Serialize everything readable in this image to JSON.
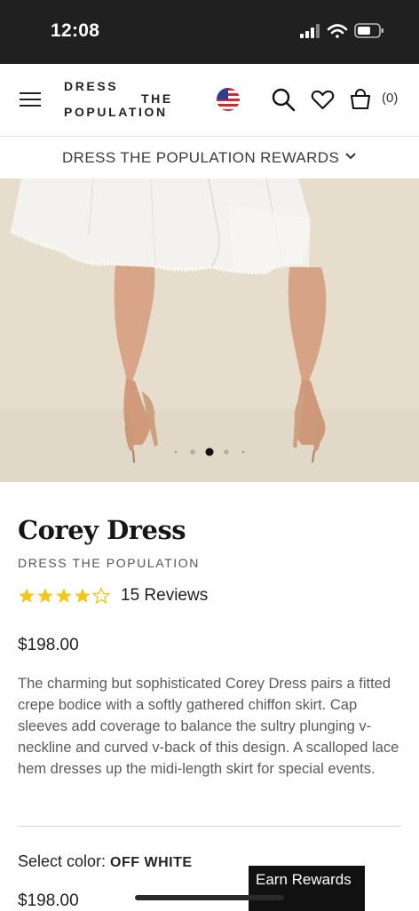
{
  "status_bar": {
    "time": "12:08"
  },
  "header": {
    "logo": {
      "word1": "DRESS",
      "word2": "THE",
      "word3": "POPULATION"
    },
    "cart_count": "(0)",
    "icons": [
      "menu-icon",
      "flag-icon",
      "search-icon",
      "heart-icon",
      "bag-icon"
    ]
  },
  "rewards_bar": {
    "label": "DRESS THE POPULATION REWARDS"
  },
  "gallery": {
    "slide_count": 5,
    "active_slide": 3
  },
  "product": {
    "title": "Corey Dress",
    "brand": "DRESS THE POPULATION",
    "rating": 4,
    "rating_max": 5,
    "reviews": "15 Reviews",
    "price": "$198.00",
    "description": "The charming but sophisticated Corey Dress pairs a fitted crepe bodice with a softly gathered chiffon skirt. Cap sleeves add coverage to balance the sultry plunging v-neckline and curved v-back of this design. A scalloped lace hem dresses up the midi-length skirt for special events.",
    "color_label": "Select color: ",
    "color_value": "OFF WHITE"
  },
  "sticky": {
    "price": "$198.00",
    "earn_rewards": "Earn Rewards"
  },
  "colors": {
    "star": "#f5c518",
    "status_bar": "#202020",
    "hero_bg": "#e8dfd0"
  }
}
